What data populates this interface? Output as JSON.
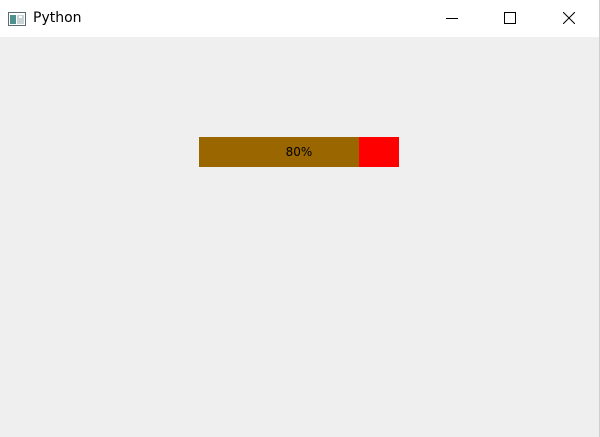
{
  "window": {
    "title": "Python"
  },
  "progress": {
    "value_percent": 80,
    "text": "80%",
    "chunk_color": "#996600",
    "track_color": "#ff0000"
  },
  "icons": {
    "app": "python-window-icon",
    "minimize": "minimize-icon",
    "maximize": "maximize-icon",
    "close": "close-icon"
  }
}
